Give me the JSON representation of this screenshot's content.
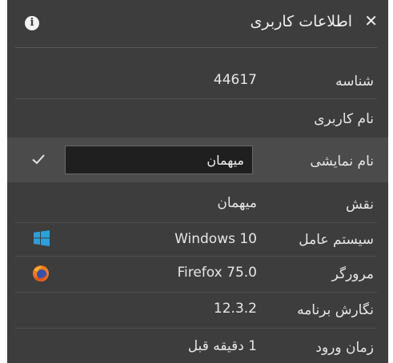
{
  "header": {
    "title": "اطلاعات کاربری",
    "close_icon": "close-icon",
    "info_icon": "info-icon",
    "info_glyph": "i",
    "close_glyph": "✕"
  },
  "rows": {
    "id": {
      "label": "شناسه",
      "value": "44617"
    },
    "username": {
      "label": "نام کاربری",
      "value": ""
    },
    "display_name": {
      "label": "نام نمایشی",
      "value": "میهمان",
      "confirm_icon": "check-icon"
    },
    "role": {
      "label": "نقش",
      "value": "میهمان"
    },
    "os": {
      "label": "سیستم عامل",
      "value": "Windows 10",
      "icon": "windows-icon"
    },
    "browser": {
      "label": "مرورگر",
      "value": "Firefox 75.0",
      "icon": "firefox-icon"
    },
    "app_version": {
      "label": "نگارش برنامه",
      "value": "12.3.2"
    },
    "login_time": {
      "label": "زمان ورود",
      "value": "1 دقیقه قبل"
    }
  },
  "colors": {
    "panel_bg": "#3d3d3d",
    "highlight_bg": "#4b4b4b",
    "input_bg": "#1f1f1f",
    "windows_blue": "#2d9fd9",
    "firefox_orange": "#f57c1f"
  }
}
